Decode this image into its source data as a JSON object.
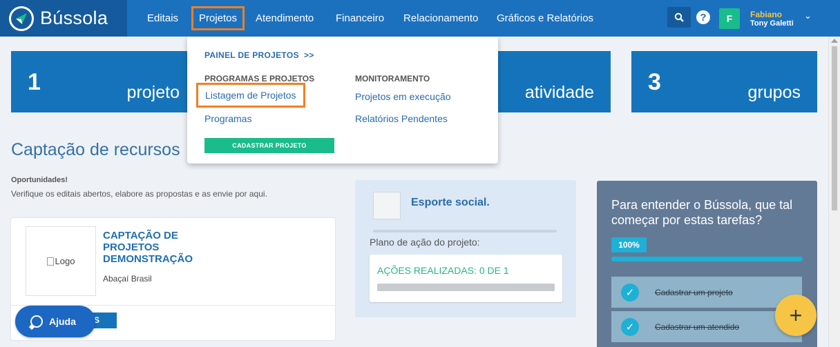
{
  "brand": {
    "name": "Bússola"
  },
  "nav": {
    "items": [
      "Editais",
      "Projetos",
      "Atendimento",
      "Financeiro",
      "Relacionamento",
      "Gráficos e Relatórios"
    ]
  },
  "user": {
    "avatar_letter": "F",
    "first_name": "Fabiano",
    "full_name": "Tony Galetti",
    "help": "?"
  },
  "stats": [
    {
      "number": "1",
      "label": "projeto"
    },
    {
      "number": "",
      "label": "atividade"
    },
    {
      "number": "3",
      "label": "grupos"
    }
  ],
  "section": {
    "title": "Captação de recursos",
    "opportunities_title": "Oportunidades!",
    "opportunities_desc": "Verifique os editais abertos, elabore as propostas e as envie por aqui."
  },
  "edital": {
    "logo_alt": "Logo",
    "title": "CAPTAÇÃO DE PROJETOS DEMONSTRAÇÃO",
    "org": "Abaçaí Brasil",
    "button": "S"
  },
  "project_card": {
    "name": "Esporte social.",
    "plan_label": "Plano de ação do projeto:",
    "actions_label": "AÇÕES REALIZADAS: 0 DE 1",
    "actions_progress": 0
  },
  "tasks": {
    "title": "Para entender o Bússola, que tal começar por estas tarefas?",
    "percent": "100%",
    "progress": 1.0,
    "items": [
      "Cadastrar um projeto",
      "Cadastrar um atendido"
    ]
  },
  "fab": {
    "label": "+"
  },
  "help_button": {
    "label": "Ajuda"
  },
  "dropdown": {
    "painel": "PAINEL DE PROJETOS  >>",
    "col1_head": "PROGRAMAS E PROJETOS",
    "col1_items": [
      "Listagem de Projetos",
      "Programas"
    ],
    "col2_head": "MONITORAMENTO",
    "col2_items": [
      "Projetos em execução",
      "Relatórios Pendentes"
    ],
    "cta": "CADASTRAR PROJETO"
  },
  "colors": {
    "nav_bg": "#1c71bf",
    "brand_bg": "#155a9c",
    "highlight": "#f07f24",
    "accent_green": "#1abc8c",
    "accent_yellow": "#f6c545",
    "tasks_bg": "#637a96"
  }
}
